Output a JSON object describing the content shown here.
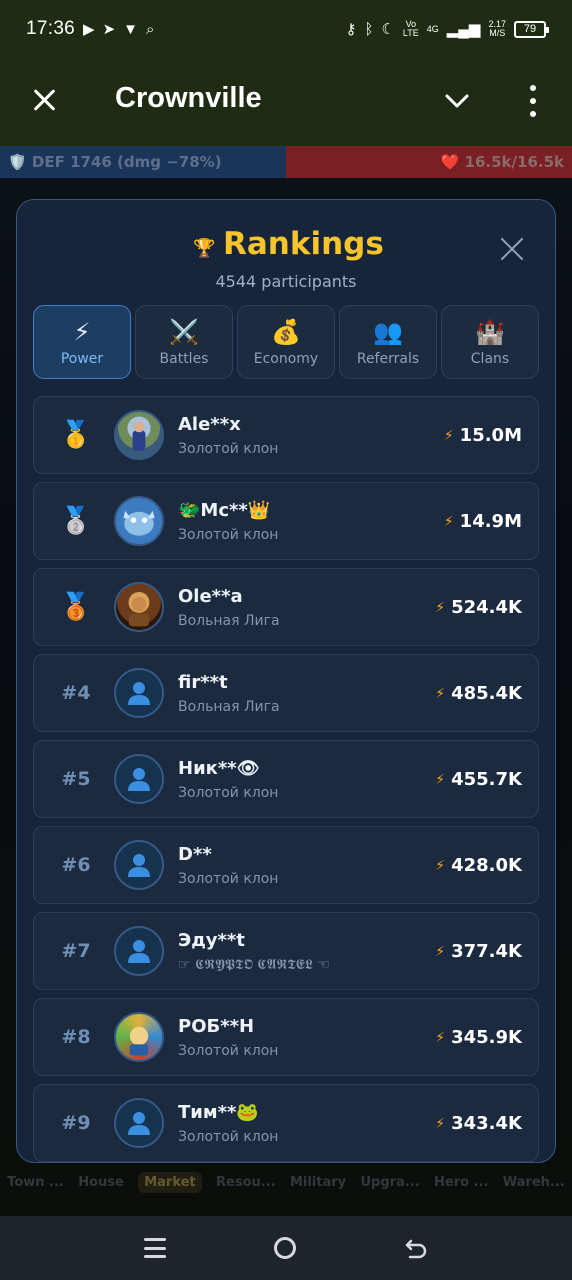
{
  "status_bar": {
    "time": "17:36",
    "network": "4G",
    "speed_value": "2.17",
    "speed_unit": "M/S",
    "battery": "79",
    "icons": [
      "youtube-icon",
      "telegram-icon",
      "shield-icon",
      "search-icon",
      "key-icon",
      "bluetooth-icon",
      "moon-icon",
      "volte-icon",
      "signal-icon"
    ]
  },
  "app_bar": {
    "title": "Crownville",
    "close_icon": "close-icon",
    "dropdown_icon": "chevron-down-icon",
    "menu_icon": "more-vert-icon"
  },
  "game_hud": {
    "def_text": "🛡️ DEF 1746 (dmg −78%)",
    "hp_text": "❤️ 16.5k/16.5k",
    "bottom_tabs": [
      "Town ...",
      "House",
      "Market",
      "Resou...",
      "Military",
      "Upgra...",
      "Hero ...",
      "Wareh..."
    ],
    "active_bottom_tab": "Market"
  },
  "rankings": {
    "trophy_icon": "🏆",
    "title": "Rankings",
    "participants": "4544 participants",
    "tabs": [
      {
        "label": "Power",
        "icon": "⚡",
        "icon_name": "lightning-icon",
        "active": true
      },
      {
        "label": "Battles",
        "icon": "⚔️",
        "icon_name": "swords-icon",
        "active": false
      },
      {
        "label": "Economy",
        "icon": "💰",
        "icon_name": "money-bag-icon",
        "active": false
      },
      {
        "label": "Referrals",
        "icon": "👥",
        "icon_name": "people-icon",
        "active": false
      },
      {
        "label": "Clans",
        "icon": "🏰",
        "icon_name": "castle-icon",
        "active": false
      }
    ],
    "players": [
      {
        "rank": "",
        "medal": "🥇",
        "name": "Ale**x",
        "clan": "Золотой клон",
        "score": "15.0M",
        "avatar": "photo"
      },
      {
        "rank": "",
        "medal": "🥈",
        "name": "🐲Mc**👑",
        "clan": "Золотой клон",
        "score": "14.9M",
        "avatar": "dragon"
      },
      {
        "rank": "",
        "medal": "🥉",
        "name": "Ole**a",
        "clan": "Вольная Лига",
        "score": "524.4K",
        "avatar": "warrior"
      },
      {
        "rank": "#4",
        "medal": "",
        "name": "fir**t",
        "clan": "Вольная Лига",
        "score": "485.4K",
        "avatar": "placeholder"
      },
      {
        "rank": "#5",
        "medal": "",
        "name": "Ник**👁",
        "clan": "Золотой клон",
        "score": "455.7K",
        "avatar": "placeholder"
      },
      {
        "rank": "#6",
        "medal": "",
        "name": "D**",
        "clan": "Золотой клон",
        "score": "428.0K",
        "avatar": "placeholder"
      },
      {
        "rank": "#7",
        "medal": "",
        "name": "Эду**t",
        "clan": "☞ 𝕮𝕽𝖄𝕻𝕿𝕺 𝕮𝕬𝕽𝕿𝕰𝕷 ☜",
        "score": "377.4K",
        "avatar": "placeholder"
      },
      {
        "rank": "#8",
        "medal": "",
        "name": "РОБ**Н",
        "clan": "Золотой клон",
        "score": "345.9K",
        "avatar": "comic"
      },
      {
        "rank": "#9",
        "medal": "",
        "name": "Тим**🐸",
        "clan": "Золотой клон",
        "score": "343.4K",
        "avatar": "placeholder"
      }
    ],
    "score_icon": "⚡"
  },
  "colors": {
    "title_gold": "#f7c52b",
    "modal_bg": "#16253a",
    "active_tab": "#3f7ec4",
    "bolt": "#f7a21b"
  }
}
